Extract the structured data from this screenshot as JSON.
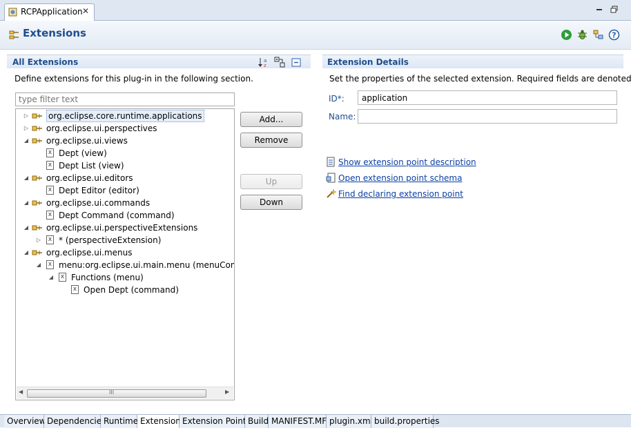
{
  "editor_tab": {
    "label": "RCPApplication",
    "close": "✕"
  },
  "header": {
    "title": "Extensions"
  },
  "all_extensions": {
    "title": "All Extensions",
    "description": "Define extensions for this plug-in in the following section.",
    "filter_placeholder": "type filter text",
    "tree": [
      {
        "label": "org.eclipse.core.runtime.applications",
        "kind": "extension",
        "twist": "▷",
        "selected": true
      },
      {
        "label": "org.eclipse.ui.perspectives",
        "kind": "extension",
        "twist": "▷"
      },
      {
        "label": "org.eclipse.ui.views",
        "kind": "extension",
        "twist": "◢"
      },
      {
        "label": "Dept (view)",
        "kind": "element",
        "twist": ""
      },
      {
        "label": "Dept List (view)",
        "kind": "element",
        "twist": ""
      },
      {
        "label": "org.eclipse.ui.editors",
        "kind": "extension",
        "twist": "◢"
      },
      {
        "label": "Dept Editor (editor)",
        "kind": "element",
        "twist": ""
      },
      {
        "label": "org.eclipse.ui.commands",
        "kind": "extension",
        "twist": "◢"
      },
      {
        "label": "Dept Command (command)",
        "kind": "element",
        "twist": ""
      },
      {
        "label": "org.eclipse.ui.perspectiveExtensions",
        "kind": "extension",
        "twist": "◢"
      },
      {
        "label": "* (perspectiveExtension)",
        "kind": "element",
        "twist": "▷"
      },
      {
        "label": "org.eclipse.ui.menus",
        "kind": "extension",
        "twist": "◢"
      },
      {
        "label": "menu:org.eclipse.ui.main.menu (menuContribu",
        "kind": "element",
        "twist": "◢"
      },
      {
        "label": "Functions (menu)",
        "kind": "element",
        "twist": "◢"
      },
      {
        "label": "Open Dept (command)",
        "kind": "element",
        "twist": ""
      }
    ],
    "buttons": {
      "add": "Add...",
      "remove": "Remove",
      "up": "Up",
      "down": "Down"
    },
    "scroll_grip": "III"
  },
  "details": {
    "title": "Extension Details",
    "description": "Set the properties of the selected extension. Required fields are denoted by \"*\".",
    "id_label": "ID*:",
    "id_value": "application",
    "name_label": "Name:",
    "name_value": "",
    "links": [
      {
        "label": "Show extension point description",
        "icon": "document-icon"
      },
      {
        "label": "Open extension point schema",
        "icon": "schema-icon"
      },
      {
        "label": "Find declaring extension point",
        "icon": "search-wand-icon"
      }
    ]
  },
  "bottom_tabs": [
    "Overview",
    "Dependencies",
    "Runtime",
    "Extensions",
    "Extension Points",
    "Build",
    "MANIFEST.MF",
    "plugin.xml",
    "build.properties"
  ],
  "active_tab": "Extensions",
  "colors": {
    "title_blue": "#1f4e8c",
    "link_blue": "#0b3ea3",
    "run_green": "#2e9e3a"
  }
}
